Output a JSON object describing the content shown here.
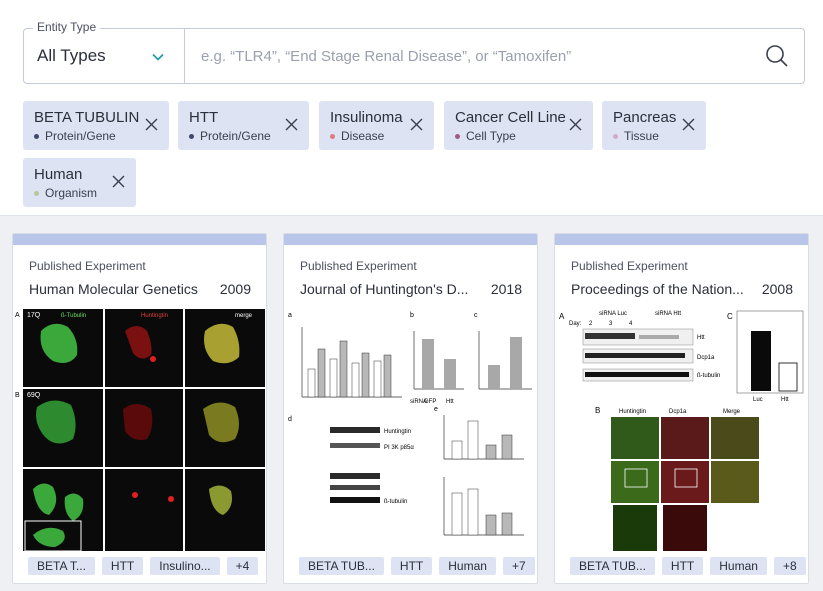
{
  "search": {
    "type_label": "Entity Type",
    "type_value": "All Types",
    "placeholder": "e.g. “TLR4”, “End Stage Renal Disease”, or “Tamoxifen”"
  },
  "filters": [
    {
      "title": "BETA TUBULIN",
      "type": "Protein/Gene",
      "dot_color": "#3d4a6b"
    },
    {
      "title": "HTT",
      "type": "Protein/Gene",
      "dot_color": "#3d4a6b"
    },
    {
      "title": "Insulinoma",
      "type": "Disease",
      "dot_color": "#e07a7a"
    },
    {
      "title": "Cancer Cell Line",
      "type": "Cell Type",
      "dot_color": "#a05a8a"
    },
    {
      "title": "Pancreas",
      "type": "Tissue",
      "dot_color": "#d8a8c8"
    },
    {
      "title": "Human",
      "type": "Organism",
      "dot_color": "#b8c89a"
    }
  ],
  "cards": [
    {
      "kind": "Published Experiment",
      "journal": "Human Molecular Genetics",
      "year": "2009",
      "tags": [
        "BETA T...",
        "HTT",
        "Insulino...",
        "+4"
      ],
      "fig_labels": [
        "A",
        "17Q",
        "ß-Tubulin",
        "Huntingtin",
        "merge",
        "B",
        "69Q"
      ]
    },
    {
      "kind": "Published Experiment",
      "journal": "Journal of Huntington's D...",
      "year": "2018",
      "tags": [
        "BETA TUB...",
        "HTT",
        "Human",
        "+7"
      ],
      "fig_labels": [
        "a",
        "b",
        "c",
        "d",
        "e",
        "siRNA",
        "GFP",
        "Htt",
        "Huntingtin",
        "PI 3K p85α",
        "ß-tubulin"
      ]
    },
    {
      "kind": "Published Experiment",
      "journal": "Proceedings of the Nation...",
      "year": "2008",
      "tags": [
        "BETA TUB...",
        "HTT",
        "Human",
        "+8"
      ],
      "fig_labels": [
        "A",
        "siRNA Luc",
        "siRNA Htt",
        "Day:",
        "2",
        "3",
        "4",
        "Htt",
        "Dcp1a",
        "ß-tubulin",
        "C",
        "Luc",
        "Htt",
        "B",
        "Huntingtin",
        "Dcp1a",
        "Merge"
      ]
    }
  ],
  "colors": {
    "chip_bg": "#dde3f3",
    "card_bar": "#b9c6ea",
    "accent": "#1a9aa0"
  }
}
